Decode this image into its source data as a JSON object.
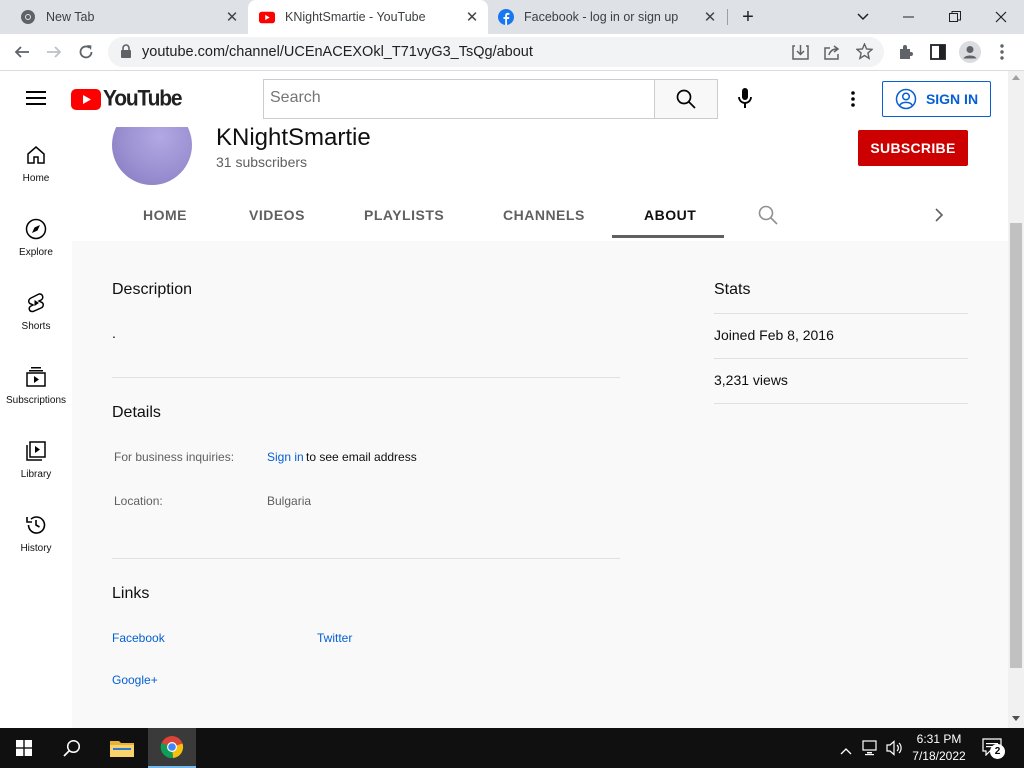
{
  "browser": {
    "tabs": [
      {
        "title": "New Tab"
      },
      {
        "title": "KNightSmartie - YouTube"
      },
      {
        "title": "Facebook - log in or sign up"
      }
    ],
    "url": "youtube.com/channel/UCEnACEXOkl_T71vyG3_TsQg/about"
  },
  "youtube": {
    "logo_text": "YouTube",
    "search_placeholder": "Search",
    "sign_in_label": "SIGN IN",
    "guide": [
      {
        "label": "Home",
        "icon": "home-icon"
      },
      {
        "label": "Explore",
        "icon": "explore-icon"
      },
      {
        "label": "Shorts",
        "icon": "shorts-icon"
      },
      {
        "label": "Subscriptions",
        "icon": "subscriptions-icon"
      },
      {
        "label": "Library",
        "icon": "library-icon"
      },
      {
        "label": "History",
        "icon": "history-icon"
      }
    ],
    "channel": {
      "name": "KNightSmartie",
      "subscribers": "31 subscribers",
      "subscribe_label": "SUBSCRIBE"
    },
    "tabs": [
      "HOME",
      "VIDEOS",
      "PLAYLISTS",
      "CHANNELS",
      "ABOUT"
    ],
    "active_tab": "ABOUT",
    "about": {
      "description_title": "Description",
      "description_text": ".",
      "details_title": "Details",
      "business_label": "For business inquiries:",
      "business_link": "Sign in",
      "business_suffix": "to see email address",
      "location_label": "Location:",
      "location_value": "Bulgaria",
      "links_title": "Links",
      "links": [
        "Facebook",
        "Twitter",
        "Google+"
      ],
      "stats_title": "Stats",
      "joined": "Joined Feb 8, 2016",
      "views": "3,231 views"
    }
  },
  "taskbar": {
    "time": "6:31 PM",
    "date": "7/18/2022",
    "notification_count": "2"
  },
  "colors": {
    "youtube_red": "#ff0000",
    "subscribe_red": "#cc0000",
    "link_blue": "#065fd4",
    "avatar": "#9a8fd0"
  }
}
